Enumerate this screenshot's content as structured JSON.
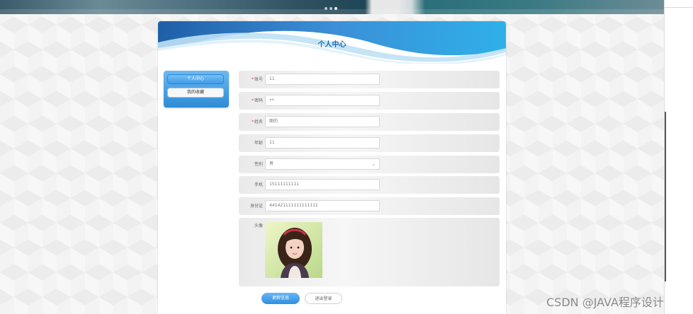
{
  "banner": {
    "dots": 3,
    "active_dot": 2
  },
  "page": {
    "title": "个人中心"
  },
  "sidebar": {
    "items": [
      {
        "label": "个人中心",
        "active": true
      },
      {
        "label": "我的收藏",
        "active": false
      }
    ]
  },
  "form": {
    "fields": [
      {
        "label": "账号",
        "required": true,
        "value": "11"
      },
      {
        "label": "密码",
        "required": true,
        "value": "••"
      },
      {
        "label": "姓名",
        "required": true,
        "value": "图的"
      },
      {
        "label": "年龄",
        "required": false,
        "value": "11"
      },
      {
        "label": "性别",
        "required": false,
        "value": "男"
      },
      {
        "label": "手机",
        "required": false,
        "value": "15111111111"
      },
      {
        "label": "身份证",
        "required": false,
        "value": "441421111111111111"
      }
    ],
    "avatar_label": "头像"
  },
  "actions": {
    "update": "更新信息",
    "logout": "退出登录"
  },
  "watermark": "CSDN @JAVA程序设计",
  "colors": {
    "accent": "#2e8bd6",
    "title": "#1e6cb3",
    "required": "#e23b3b"
  }
}
